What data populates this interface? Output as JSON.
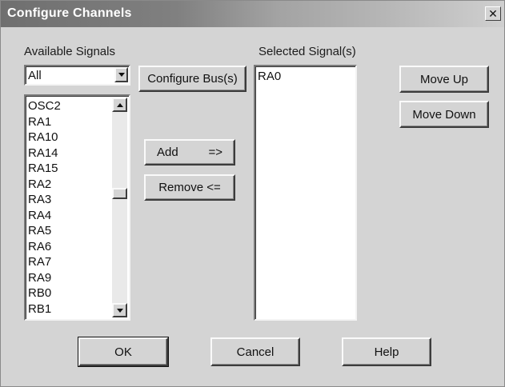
{
  "window": {
    "title": "Configure Channels",
    "close_glyph": "✕"
  },
  "available": {
    "label": "Available Signals",
    "filter_value": "All",
    "items": [
      "OSC2",
      "RA1",
      "RA10",
      "RA14",
      "RA15",
      "RA2",
      "RA3",
      "RA4",
      "RA5",
      "RA6",
      "RA7",
      "RA9",
      "RB0",
      "RB1"
    ]
  },
  "selected": {
    "label": "Selected Signal(s)",
    "items": [
      "RA0"
    ]
  },
  "buttons": {
    "configure_bus": "Configure Bus(s)",
    "add": "Add",
    "add_arrow": "=>",
    "remove": "Remove <=",
    "move_up": "Move Up",
    "move_down": "Move Down",
    "ok": "OK",
    "cancel": "Cancel",
    "help": "Help"
  },
  "icons": {
    "combo_arrow": "chevron-down-icon",
    "scroll_up": "scroll-up-arrow-icon",
    "scroll_down": "scroll-down-arrow-icon"
  }
}
